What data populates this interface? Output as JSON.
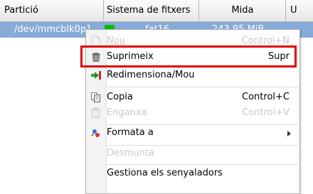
{
  "table": {
    "headers": [
      "Partició",
      "Sistema de fitxers",
      "Mida",
      "U"
    ],
    "selected_row": {
      "partition": "/dev/mmcblk0p1",
      "filesystem": "fat16",
      "size": "243.95 MiB",
      "filesystem_color": "#00c000"
    }
  },
  "menu": {
    "items": [
      {
        "label": "Nou",
        "accel": "Control+N",
        "enabled": false,
        "icon": "new-file-icon"
      },
      {
        "label": "Suprimeix",
        "accel": "Supr",
        "enabled": true,
        "icon": "trash-icon"
      },
      {
        "label": "Redimensiona/Mou",
        "accel": "",
        "enabled": true,
        "icon": "resize-move-icon"
      },
      {
        "label": "Copia",
        "accel": "Control+C",
        "enabled": true,
        "icon": "copy-icon"
      },
      {
        "label": "Enganxa",
        "accel": "Control+V",
        "enabled": false,
        "icon": "paste-icon"
      },
      {
        "label": "Formata a",
        "accel": "",
        "enabled": true,
        "icon": "format-icon"
      },
      {
        "label": "Desmunta",
        "accel": "",
        "enabled": false,
        "icon": ""
      },
      {
        "label": "Gestiona els senyaladors",
        "accel": "",
        "enabled": true,
        "icon": ""
      }
    ]
  },
  "colors": {
    "selection": "#86abd9",
    "highlight_border": "#e00000"
  }
}
